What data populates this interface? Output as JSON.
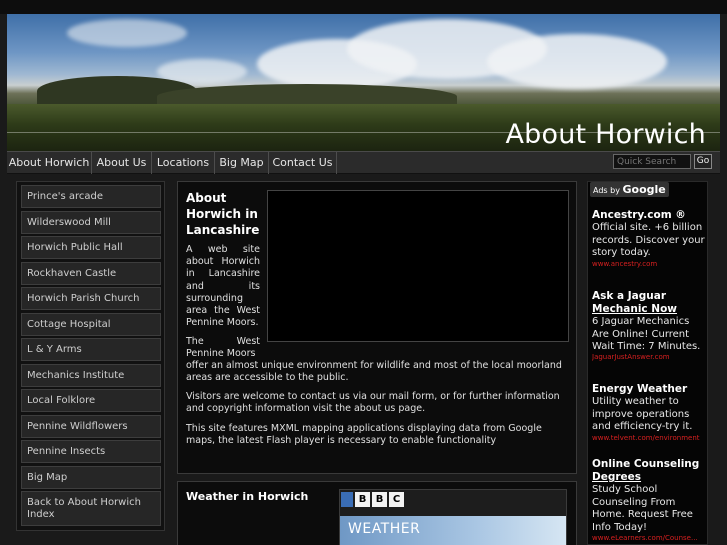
{
  "header": {
    "title": "About Horwich"
  },
  "nav": {
    "items": [
      "About Horwich",
      "About Us",
      "Locations",
      "Big Map",
      "Contact Us"
    ],
    "search_placeholder": "Quick Search",
    "go_label": "Go"
  },
  "sidebar": {
    "items": [
      "Prince's arcade",
      "Wilderswood Mill",
      "Horwich Public Hall",
      "Rockhaven Castle",
      "Horwich Parish Church",
      "Cottage Hospital",
      "L & Y Arms",
      "Mechanics Institute",
      "Local Folklore",
      "Pennine Wildflowers",
      "Pennine Insects",
      "Big Map",
      "Back to About Horwich Index"
    ]
  },
  "main": {
    "about_title": "About Horwich in Lancashire",
    "intro_left": "A web site about Horwich in Lancashire and its surrounding area the West Pennine Moors.",
    "moors_start": "The West Pennine Moors",
    "moors_rest": "offer an almost unique environment for wildlife and most of the local moorland areas are accessible to the public.",
    "contact_text": "Visitors are welcome to contact us via our mail form, or for further information and copyright information visit the about us page.",
    "mxml_text": "This site features MXML mapping applications displaying data from Google maps, the latest Flash player is necessary to enable functionality",
    "weather_title": "Weather in Horwich",
    "bbc_letters": [
      "B",
      "B",
      "C"
    ],
    "weather_banner": "WEATHER"
  },
  "ads": {
    "label_prefix": "Ads by",
    "label_brand": "Google",
    "items": [
      {
        "title": "Ancestry.com ®",
        "body": "Official site. +6 billion records. Discover your story today.",
        "url": "www.ancestry.com"
      },
      {
        "title_plain": "Ask a Jaguar",
        "title_underlined": "Mechanic Now",
        "body": "6 Jaguar Mechanics Are Online! Current Wait Time: 7 Minutes.",
        "url": "JaguarJustAnswer.com"
      },
      {
        "title": "Energy Weather",
        "body": "Utility weather to improve operations and efficiency-try it.",
        "url": "www.telvent.com/environment"
      },
      {
        "title_plain": "Online Counseling",
        "title_underlined": "Degrees",
        "body": "Study School Counseling From Home. Request Free Info Today!",
        "url": "www.eLearners.com/Counse..."
      }
    ]
  },
  "colors": {
    "background": "#1a1a1a",
    "nav_bar": "#2b2b2b",
    "ad_url": "#d62020"
  }
}
